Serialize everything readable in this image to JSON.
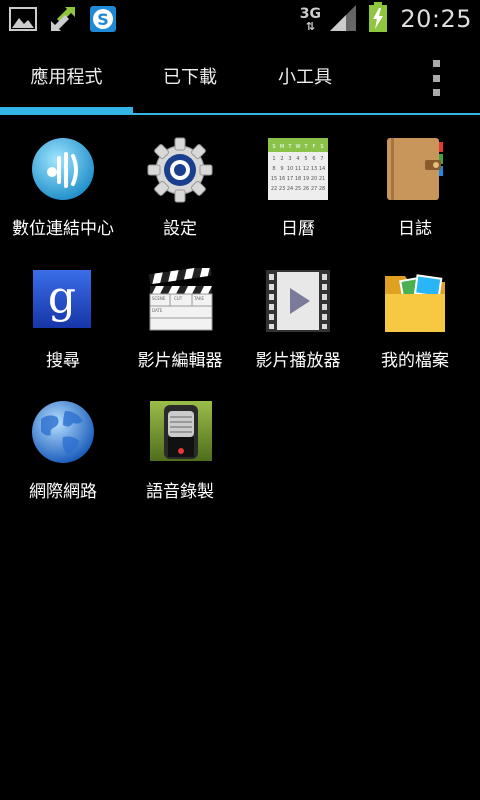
{
  "status_bar": {
    "network": "3G",
    "time": "20:25",
    "icons": [
      "image-icon",
      "sync-arrows-icon",
      "skype-icon",
      "signal-icon",
      "battery-charging-icon"
    ]
  },
  "tabs": [
    {
      "label": "應用程式",
      "selected": true
    },
    {
      "label": "已下載",
      "selected": false
    },
    {
      "label": "小工具",
      "selected": false
    }
  ],
  "accent_color": "#33b5e5",
  "apps": [
    {
      "label": "數位連結中心",
      "icon": "allshare-icon"
    },
    {
      "label": "設定",
      "icon": "settings-gear-icon"
    },
    {
      "label": "日曆",
      "icon": "calendar-icon"
    },
    {
      "label": "日誌",
      "icon": "journal-icon"
    },
    {
      "label": "搜尋",
      "icon": "google-search-icon"
    },
    {
      "label": "影片編輯器",
      "icon": "clapperboard-icon"
    },
    {
      "label": "影片播放器",
      "icon": "video-player-icon"
    },
    {
      "label": "我的檔案",
      "icon": "folder-icon"
    },
    {
      "label": "網際網路",
      "icon": "globe-icon"
    },
    {
      "label": "語音錄製",
      "icon": "voice-recorder-icon"
    }
  ],
  "calendar_icon": {
    "weekdays": [
      "S",
      "M",
      "T",
      "W",
      "T",
      "F",
      "S"
    ],
    "days": [
      "1",
      "2",
      "3",
      "4",
      "5",
      "6",
      "7",
      "8",
      "9",
      "10",
      "11",
      "12",
      "13",
      "14",
      "15",
      "16",
      "17",
      "18",
      "19",
      "20",
      "21",
      "22",
      "23",
      "24",
      "25",
      "26",
      "27",
      "28"
    ]
  },
  "clapper_icon": {
    "fields": [
      "SCENE",
      "CUT",
      "TAKE",
      "DATE"
    ]
  }
}
